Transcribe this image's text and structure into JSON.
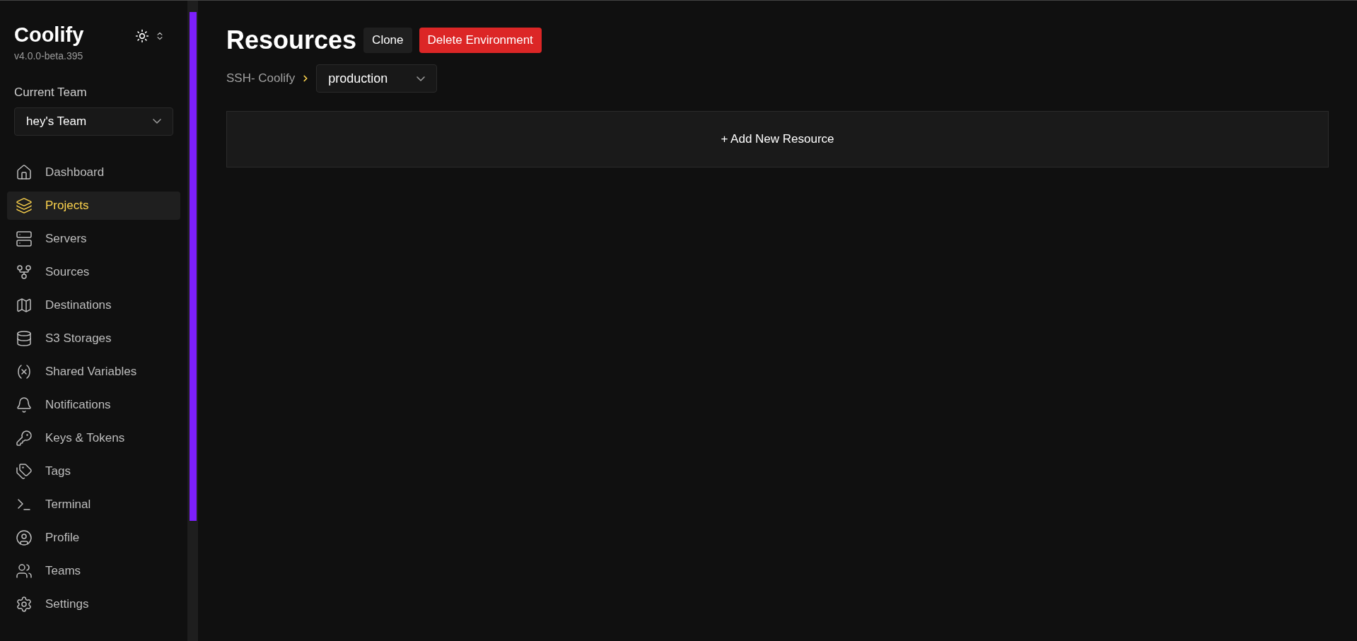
{
  "sidebar": {
    "brand": "Coolify",
    "version": "v4.0.0-beta.395",
    "team_label": "Current Team",
    "team_select": {
      "value": "hey's Team"
    },
    "items": [
      {
        "kind": "dashboard",
        "label": "Dashboard",
        "selected": false
      },
      {
        "kind": "projects",
        "label": "Projects",
        "selected": true
      },
      {
        "kind": "servers",
        "label": "Servers",
        "selected": false
      },
      {
        "kind": "sources",
        "label": "Sources",
        "selected": false
      },
      {
        "kind": "destinations",
        "label": "Destinations",
        "selected": false
      },
      {
        "kind": "storages",
        "label": "S3 Storages",
        "selected": false
      },
      {
        "kind": "variables",
        "label": "Shared Variables",
        "selected": false
      },
      {
        "kind": "notifications",
        "label": "Notifications",
        "selected": false
      },
      {
        "kind": "keys",
        "label": "Keys & Tokens",
        "selected": false
      },
      {
        "kind": "tags",
        "label": "Tags",
        "selected": false
      },
      {
        "kind": "terminal",
        "label": "Terminal",
        "selected": false
      },
      {
        "kind": "profile",
        "label": "Profile",
        "selected": false
      },
      {
        "kind": "teams",
        "label": "Teams",
        "selected": false
      },
      {
        "kind": "settings",
        "label": "Settings",
        "selected": false
      }
    ]
  },
  "header": {
    "title": "Resources",
    "buttons": [
      {
        "kind": "neutral",
        "label": "Clone"
      },
      {
        "kind": "danger",
        "label": "Delete Environment"
      }
    ]
  },
  "breadcrumb": {
    "project": "SSH- Coolify",
    "environment_select": {
      "value": "production"
    }
  },
  "add_resource": {
    "label": "+ Add New Resource"
  }
}
